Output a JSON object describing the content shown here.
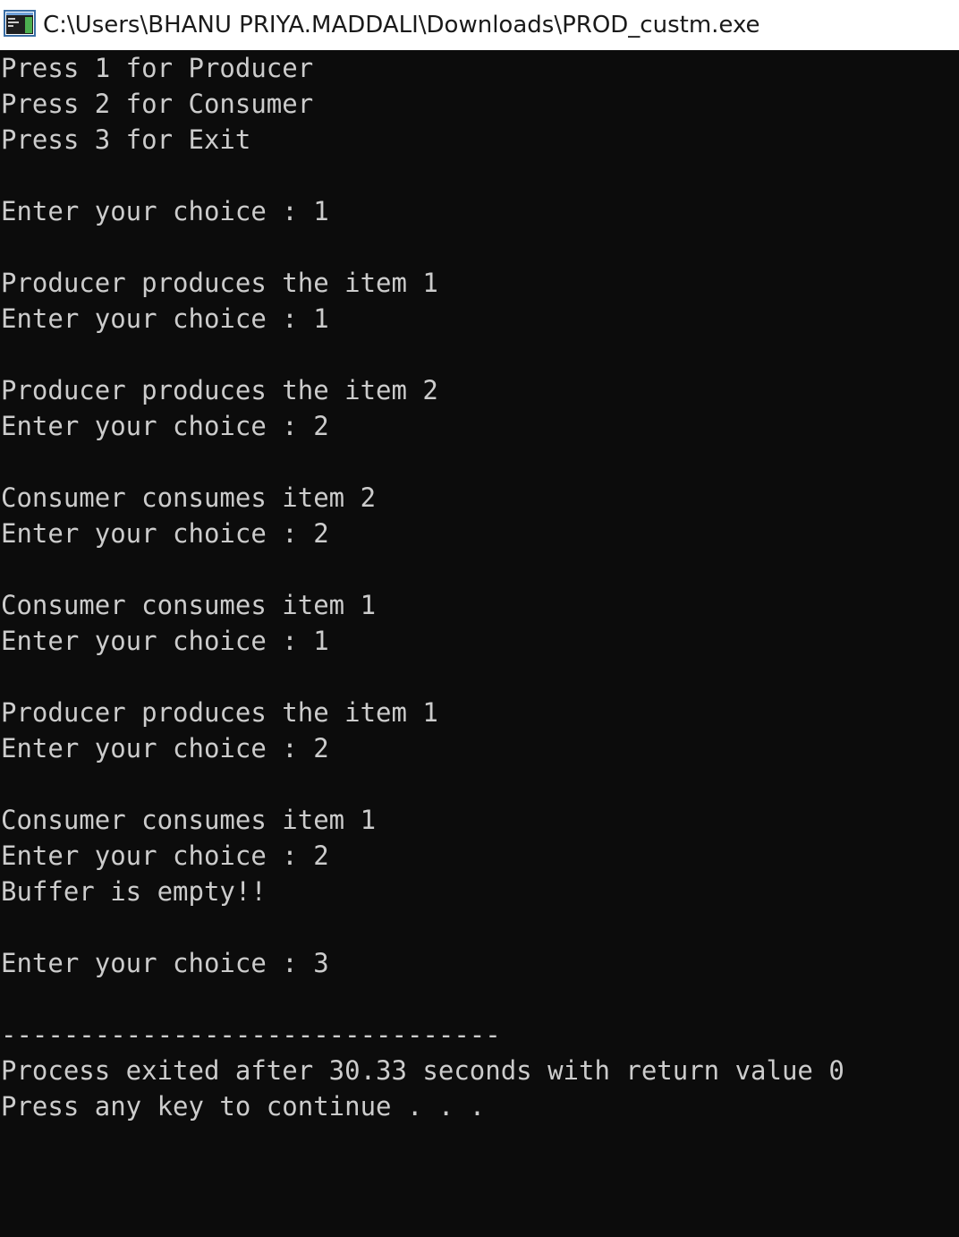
{
  "window": {
    "title": "C:\\Users\\BHANU PRIYA.MADDALI\\Downloads\\PROD_custm.exe",
    "icon": "console-app-icon"
  },
  "console": {
    "background": "#0c0c0c",
    "foreground": "#cccccc",
    "lines": [
      "Press 1 for Producer",
      "Press 2 for Consumer",
      "Press 3 for Exit",
      "",
      "Enter your choice : 1",
      "",
      "Producer produces the item 1",
      "Enter your choice : 1",
      "",
      "Producer produces the item 2",
      "Enter your choice : 2",
      "",
      "Consumer consumes item 2",
      "Enter your choice : 2",
      "",
      "Consumer consumes item 1",
      "Enter your choice : 1",
      "",
      "Producer produces the item 1",
      "Enter your choice : 2",
      "",
      "Consumer consumes item 1",
      "Enter your choice : 2",
      "Buffer is empty!!",
      "",
      "Enter your choice : 3",
      "",
      "--------------------------------",
      "Process exited after 30.33 seconds with return value 0",
      "Press any key to continue . . ."
    ]
  }
}
